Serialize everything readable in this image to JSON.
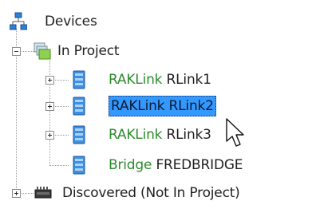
{
  "tree": {
    "root": {
      "label": "Devices",
      "icon": "device-network-icon"
    },
    "project": {
      "label": "In Project",
      "icon": "project-screens-icon",
      "expanded": true
    },
    "devices": [
      {
        "type": "RAKLink",
        "name": "RLink1",
        "icon": "device-module-icon",
        "expander": "plus",
        "selected": false
      },
      {
        "type": "RAKLink",
        "name": "RLink2",
        "icon": "device-module-icon",
        "expander": "plus",
        "selected": true
      },
      {
        "type": "RAKLink",
        "name": "RLink3",
        "icon": "device-module-icon",
        "expander": "plus",
        "selected": false
      },
      {
        "type": "Bridge",
        "name": "FREDBRIDGE",
        "icon": "device-module-icon",
        "expander": "none",
        "selected": false
      }
    ],
    "discovered": {
      "label": "Discovered (Not In Project)",
      "icon": "network-switch-icon",
      "expander": "plus"
    }
  },
  "colors": {
    "type_text": "#2e8b2e",
    "selection": "#3399ff",
    "tree_lines": "#9a9a9a"
  },
  "cursor": {
    "icon": "mouse-pointer-icon"
  }
}
